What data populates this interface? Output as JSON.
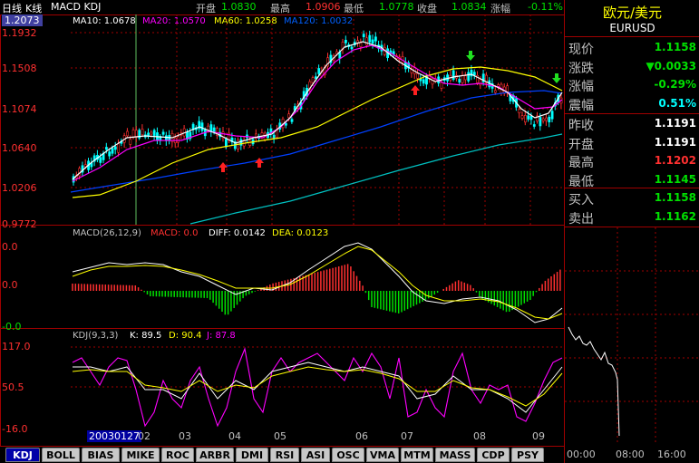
{
  "header": {
    "chart_type_label": "日线",
    "kline_label": "K线",
    "indicators_label": "MACD KDJ",
    "open_label": "开盘",
    "open_value": "1.0830",
    "high_label": "最高",
    "high_value": "1.0906",
    "low_label": "最低",
    "low_value": "1.0778",
    "close_label": "收盘",
    "close_value": "1.0834",
    "change_label": "涨幅",
    "change_value": "-0.11%"
  },
  "ma": {
    "ma10": "MA10: 1.0678",
    "ma20": "MA20: 1.0570",
    "ma60": "MA60: 1.0258",
    "ma120": "MA120: 1.0032"
  },
  "price_axis": [
    "1.2073",
    "1.1932",
    "1.1508",
    "1.1074",
    "1.0640",
    "1.0206",
    "0.9772"
  ],
  "macd_header": {
    "name": "MACD(26,12,9)",
    "macd": "MACD: 0.0",
    "diff": "DIFF: 0.0142",
    "dea": "DEA: 0.0123"
  },
  "macd_axis": [
    "0.0",
    "0.0",
    "-0.0"
  ],
  "kdj_header": {
    "name": "KDJ(9,3,3)",
    "k": "K: 89.5",
    "d": "D: 90.4",
    "j": "J: 87.8"
  },
  "kdj_axis": [
    "117.0",
    "50.5",
    "-16.0"
  ],
  "date_axis": {
    "cursor_date": "20030127",
    "months": [
      "02",
      "03",
      "04",
      "05",
      "06",
      "07",
      "08",
      "09"
    ]
  },
  "tabs": [
    "KDJ",
    "BOLL",
    "BIAS",
    "MIKE",
    "ROC",
    "ARBR",
    "DMI",
    "RSI",
    "ASI",
    "OSC",
    "VMA",
    "MTM",
    "MASS",
    "CDP",
    "PSY"
  ],
  "active_tab": "KDJ",
  "quote": {
    "title": "欧元/美元",
    "code": "EURUSD",
    "rows1": [
      {
        "label": "现价",
        "value": "1.1158",
        "color": "#00e000"
      },
      {
        "label": "涨跌",
        "value": "▼0.0033",
        "color": "#00e000"
      },
      {
        "label": "涨幅",
        "value": "-0.29%",
        "color": "#00e000"
      },
      {
        "label": "震幅",
        "value": "0.51%",
        "color": "#00ffff"
      }
    ],
    "rows2": [
      {
        "label": "昨收",
        "value": "1.1191",
        "color": "#ffffff"
      },
      {
        "label": "开盘",
        "value": "1.1191",
        "color": "#ffffff"
      },
      {
        "label": "最高",
        "value": "1.1202",
        "color": "#ff3030"
      },
      {
        "label": "最低",
        "value": "1.1145",
        "color": "#00e000"
      }
    ],
    "rows3": [
      {
        "label": "买入",
        "value": "1.1158",
        "color": "#00e000"
      },
      {
        "label": "卖出",
        "value": "1.1162",
        "color": "#00e000"
      }
    ]
  },
  "intraday_times": [
    "00:00",
    "08:00",
    "16:00"
  ],
  "colors": {
    "up": "#ff3030",
    "down": "#00ffff",
    "ma10": "#ffffff",
    "ma20": "#ff00ff",
    "ma60": "#ffff00",
    "ma120": "#0040ff",
    "border": "#a00000"
  }
}
